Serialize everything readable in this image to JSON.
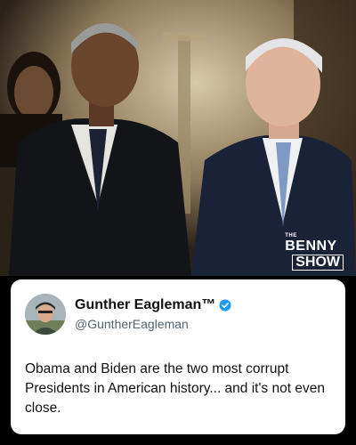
{
  "logo": {
    "line1": "THE",
    "line2": "BENNY",
    "line3": "SHOW"
  },
  "tweet": {
    "author_name": "Gunther Eagleman™",
    "handle": "@GuntherEagleman",
    "text": "Obama and Biden are the two most corrupt Presidents in American history... and it's not even close.",
    "verified_color": "#1d9bf0"
  }
}
